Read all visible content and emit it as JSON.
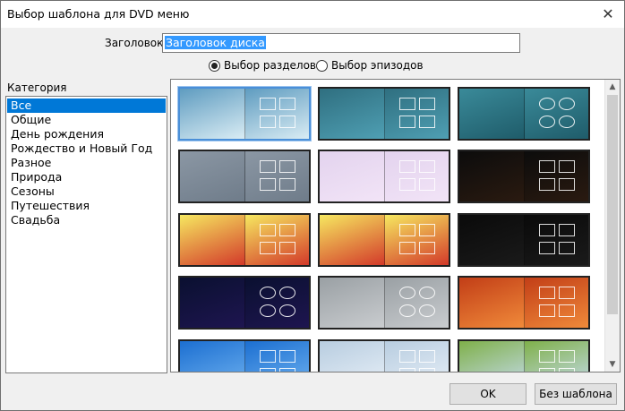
{
  "window": {
    "title": "Выбор шаблона для DVD меню",
    "close_glyph": "✕"
  },
  "heading": {
    "label": "Заголовок:",
    "value": "Заголовок диска"
  },
  "mode": {
    "options": [
      "Выбор разделов",
      "Выбор эпизодов"
    ],
    "selected": 0
  },
  "category": {
    "label": "Категория",
    "items": [
      "Все",
      "Общие",
      "День рождения",
      "Рождество и Новый Год",
      "Разное",
      "Природа",
      "Сезоны",
      "Путешествия",
      "Свадьба"
    ],
    "selected": 0
  },
  "templates": [
    {
      "name": "blue-waves",
      "colors": [
        "#5f9cc0",
        "#d9ecf4"
      ]
    },
    {
      "name": "teal-mist",
      "colors": [
        "#2f6f80",
        "#4f9fb3"
      ]
    },
    {
      "name": "teal-ovals",
      "colors": [
        "#3a8a99",
        "#1f5c6a"
      ]
    },
    {
      "name": "grey-slate",
      "colors": [
        "#8b97a4",
        "#6f7c8a"
      ]
    },
    {
      "name": "party-confetti",
      "colors": [
        "#e3d3ee",
        "#f2e4f7"
      ]
    },
    {
      "name": "birthday-cake",
      "colors": [
        "#0c0c0c",
        "#2a1a10"
      ]
    },
    {
      "name": "christmas-trees-1",
      "colors": [
        "#f6e860",
        "#d33a2a"
      ]
    },
    {
      "name": "christmas-trees-2",
      "colors": [
        "#f6e860",
        "#d33a2a"
      ]
    },
    {
      "name": "fireworks",
      "colors": [
        "#0a0a0a",
        "#1a1a1a"
      ]
    },
    {
      "name": "dark-swirl",
      "colors": [
        "#0a1030",
        "#1e1550"
      ]
    },
    {
      "name": "penguin-grey",
      "colors": [
        "#9aa0a4",
        "#c9cccf"
      ]
    },
    {
      "name": "sunset-clouds",
      "colors": [
        "#c23e17",
        "#f08a3a"
      ]
    },
    {
      "name": "winter-blue",
      "colors": [
        "#1c6fd1",
        "#6fb2f0"
      ]
    },
    {
      "name": "frost-trees",
      "colors": [
        "#b8cde0",
        "#e8f0f8"
      ]
    },
    {
      "name": "spring-trees",
      "colors": [
        "#7fb04a",
        "#c6dcef"
      ]
    }
  ],
  "buttons": {
    "ok": "OK",
    "no_template": "Без шаблона"
  }
}
